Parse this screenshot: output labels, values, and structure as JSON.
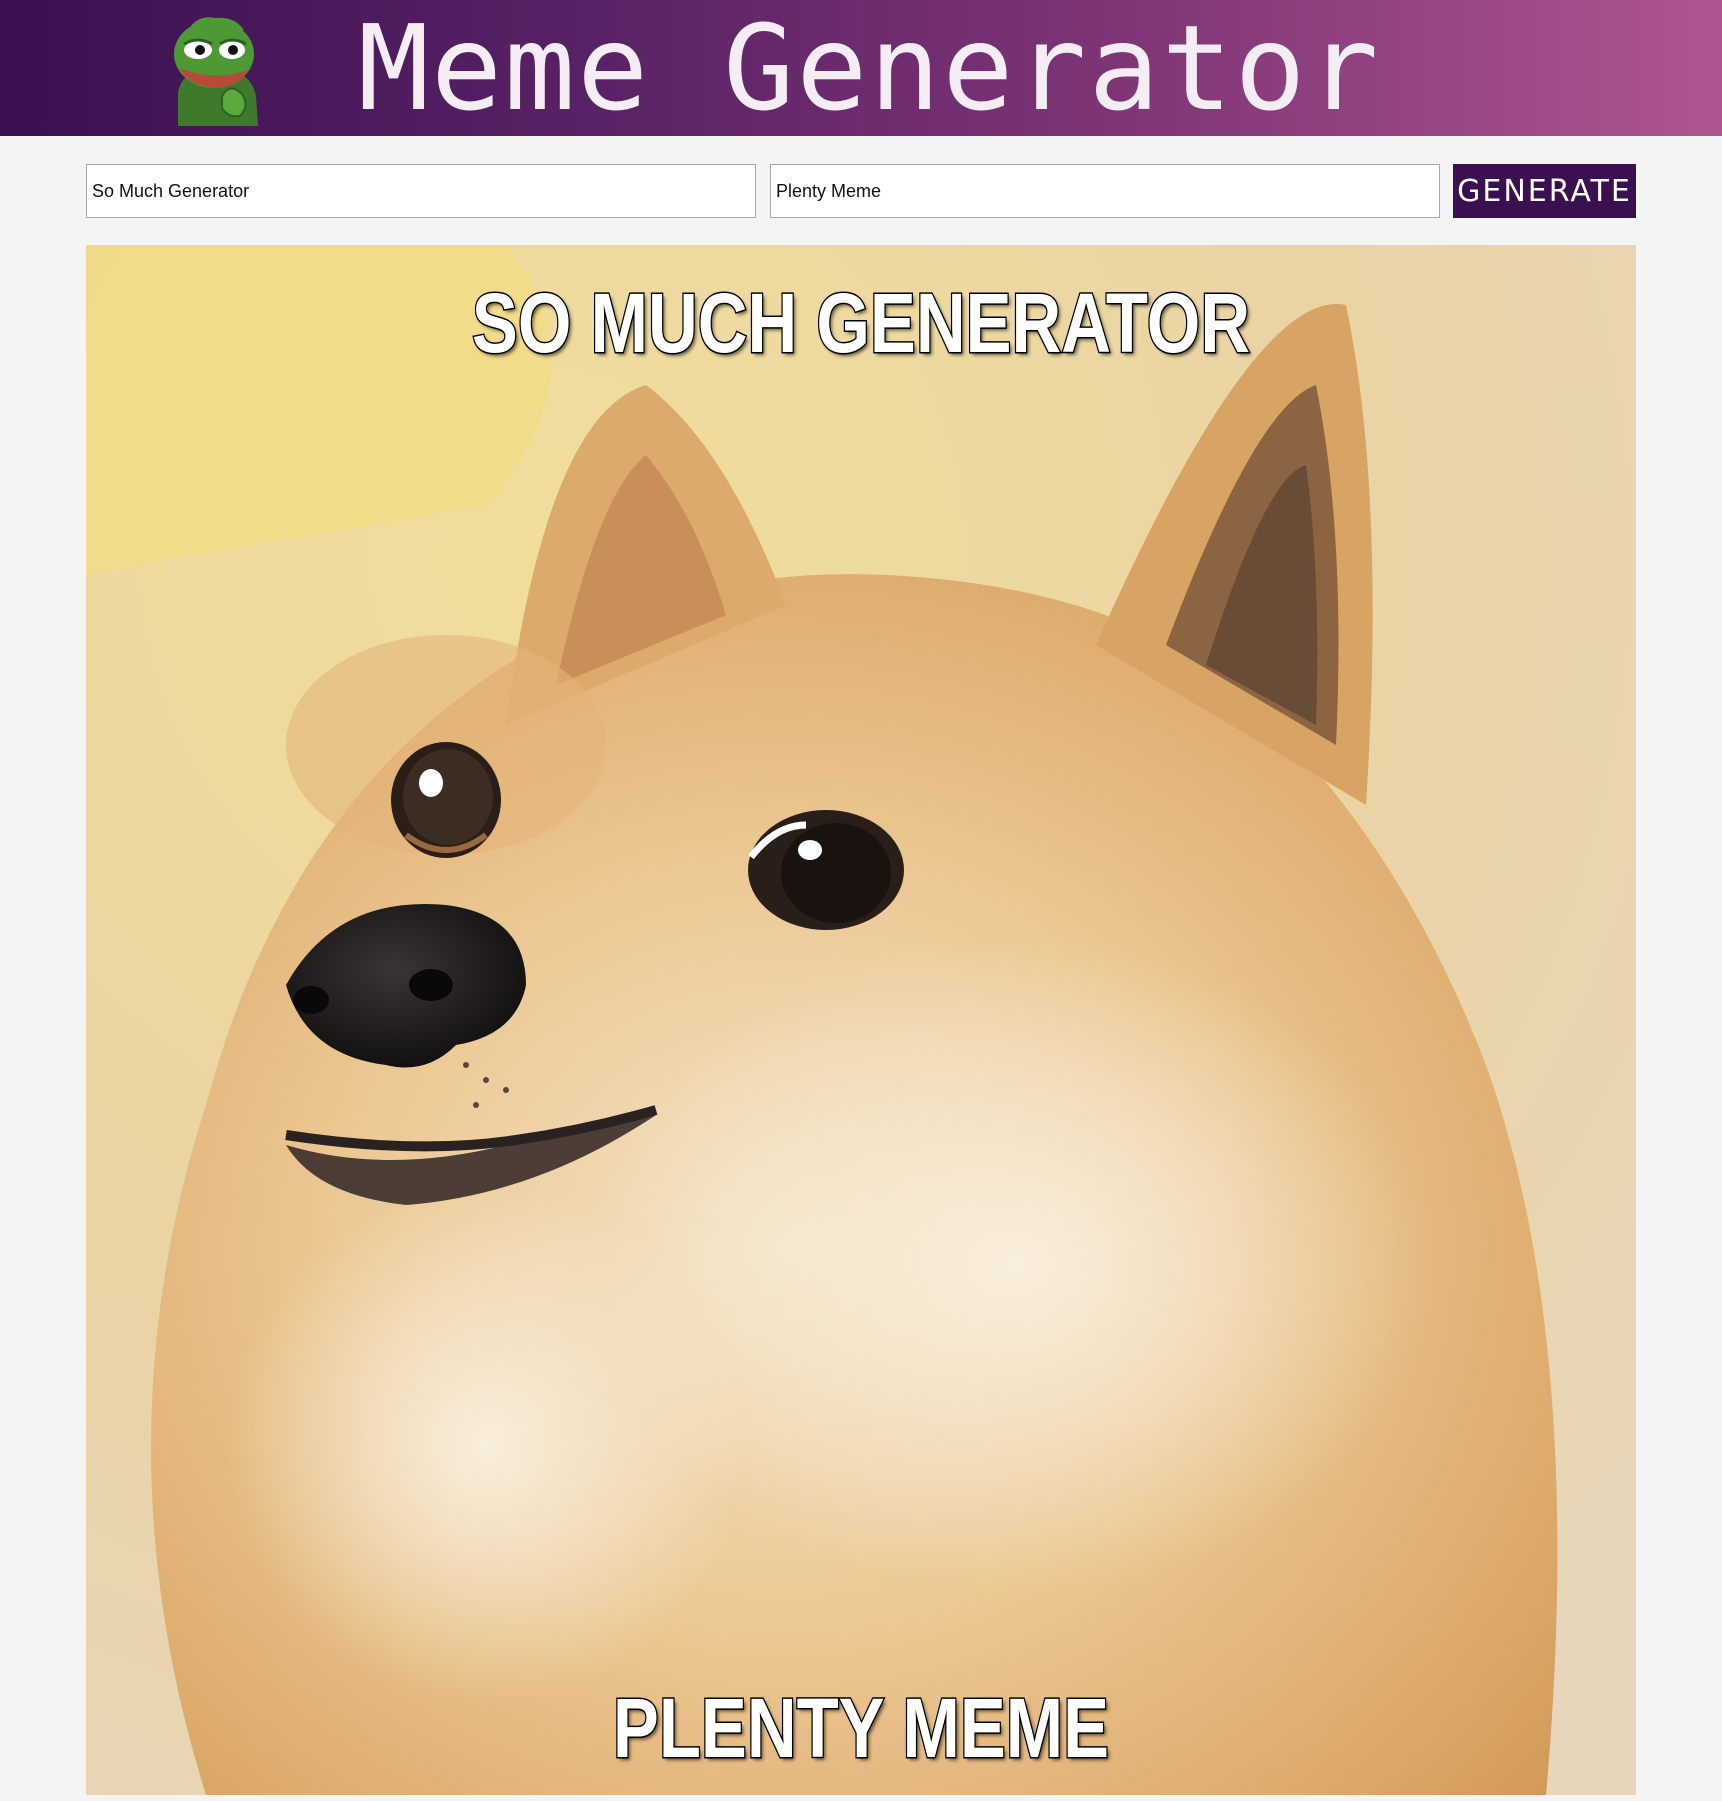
{
  "header": {
    "title": "Meme Generator",
    "gradient_start": "#3a1050",
    "gradient_end": "#b05590",
    "logo_icon": "pepe-frog-icon"
  },
  "form": {
    "top_text_value": "So Much Generator",
    "bottom_text_value": "Plenty Meme",
    "generate_label": "GENERATE",
    "button_color": "#3a1050"
  },
  "meme": {
    "image": "doge-shiba-inu-image",
    "top_caption": "SO MUCH GENERATOR",
    "bottom_caption": "PLENTY MEME"
  }
}
